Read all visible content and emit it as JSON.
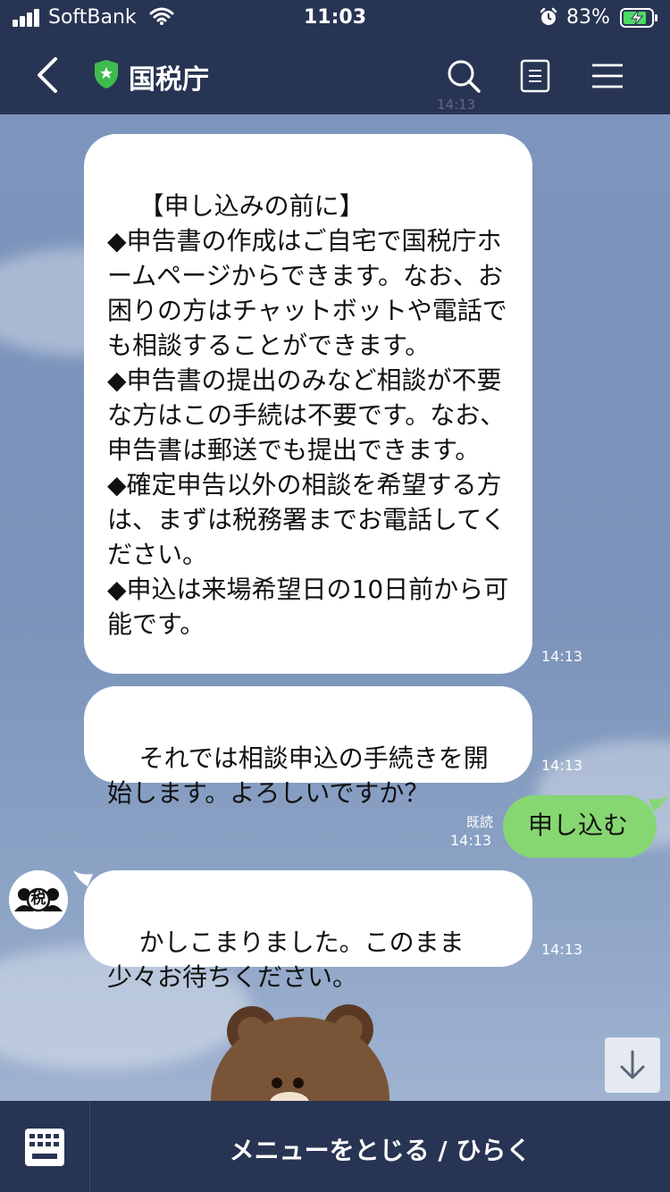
{
  "status_bar": {
    "carrier": "SoftBank",
    "time": "11:03",
    "battery_percent": "83%",
    "icons": [
      "signal-icon",
      "wifi-icon",
      "alarm-icon",
      "battery-charging-icon"
    ]
  },
  "header": {
    "title": "国税庁",
    "icons": [
      "back-icon",
      "verified-shield-icon",
      "search-icon",
      "notes-icon",
      "menu-icon"
    ],
    "ghost_time": "14:13"
  },
  "messages": [
    {
      "direction": "in",
      "text": "【申し込みの前に】\n◆申告書の作成はご自宅で国税庁ホームページからできます。なお、お困りの方はチャットボットや電話でも相談することができます。\n◆申告書の提出のみなど相談が不要な方はこの手続は不要です。なお、申告書は郵送でも提出できます。\n◆確定申告以外の相談を希望する方は、まずは税務署までお電話してください。\n◆申込は来場希望日の10日前から可能です。",
      "time": "14:13"
    },
    {
      "direction": "in",
      "text": "それでは相談申込の手続きを開始します。よろしいですか？",
      "time": "14:13"
    },
    {
      "direction": "out",
      "text": "申し込む",
      "read": "既読",
      "time": "14:13"
    },
    {
      "direction": "in",
      "text": "かしこまりました。このまま少々お待ちください。",
      "time": "14:13",
      "avatar_text": "税"
    }
  ],
  "bottom_bar": {
    "menu_toggle_label": "メニューをとじる / ひらく",
    "keyboard_icon": "keyboard-icon"
  },
  "colors": {
    "header_bg": "#283453",
    "chat_bg": "#7a93bb",
    "incoming_bubble": "#ffffff",
    "outgoing_bubble": "#86d672",
    "verified_shield": "#3dbb4f"
  }
}
